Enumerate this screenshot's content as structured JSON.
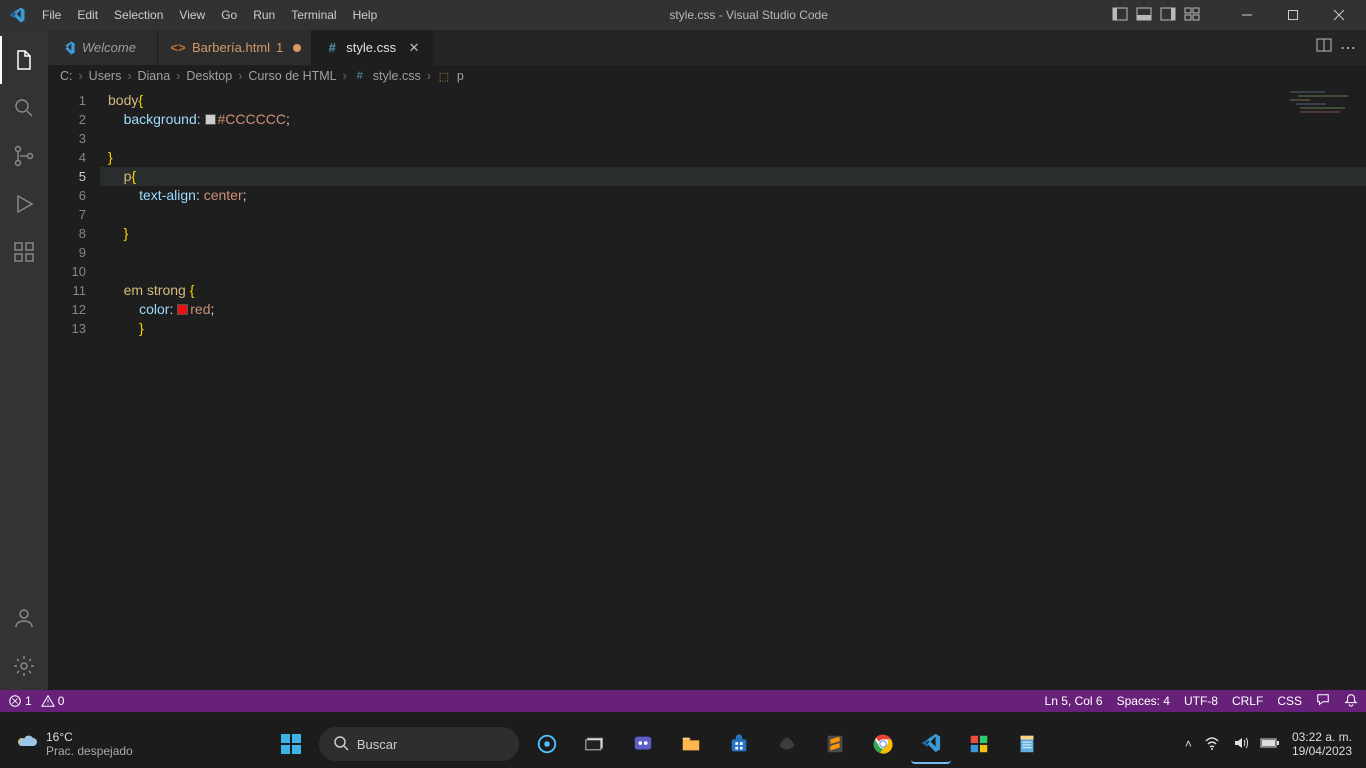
{
  "titlebar": {
    "menu": [
      "File",
      "Edit",
      "Selection",
      "View",
      "Go",
      "Run",
      "Terminal",
      "Help"
    ],
    "title": "style.css - Visual Studio Code"
  },
  "tabs": [
    {
      "id": "welcome",
      "label": "Welcome",
      "kind": "welcome",
      "modified": false,
      "active": false
    },
    {
      "id": "barberia",
      "label": "Barbería.html",
      "kind": "html",
      "modified": true,
      "suffix": "1",
      "active": false
    },
    {
      "id": "style",
      "label": "style.css",
      "kind": "css",
      "modified": false,
      "active": true
    }
  ],
  "breadcrumb": {
    "segments": [
      "C:",
      "Users",
      "Diana",
      "Desktop",
      "Curso de HTML"
    ],
    "file": "style.css",
    "symbol": "p"
  },
  "code": {
    "currentLine": 5,
    "lines": [
      {
        "n": 1,
        "indent": 0,
        "tokens": [
          [
            "sel",
            "body"
          ],
          [
            "brace",
            "{"
          ]
        ]
      },
      {
        "n": 2,
        "indent": 1,
        "tokens": [
          [
            "prop",
            "background"
          ],
          [
            "punc",
            ": "
          ],
          [
            "swatch",
            "#CCCCCC"
          ],
          [
            "val",
            "#CCCCCC"
          ],
          [
            "punc",
            ";"
          ]
        ]
      },
      {
        "n": 3,
        "indent": 0,
        "tokens": []
      },
      {
        "n": 4,
        "indent": 0,
        "tokens": [
          [
            "brace",
            "}"
          ]
        ]
      },
      {
        "n": 5,
        "indent": 1,
        "tokens": [
          [
            "sel",
            "p"
          ],
          [
            "brace",
            "{"
          ]
        ]
      },
      {
        "n": 6,
        "indent": 2,
        "tokens": [
          [
            "prop",
            "text-align"
          ],
          [
            "punc",
            ": "
          ],
          [
            "val",
            "center"
          ],
          [
            "punc",
            ";"
          ]
        ]
      },
      {
        "n": 7,
        "indent": 2,
        "tokens": []
      },
      {
        "n": 8,
        "indent": 1,
        "tokens": [
          [
            "brace",
            "}"
          ]
        ]
      },
      {
        "n": 9,
        "indent": 0,
        "tokens": []
      },
      {
        "n": 10,
        "indent": 0,
        "tokens": []
      },
      {
        "n": 11,
        "indent": 1,
        "tokens": [
          [
            "sel",
            "em "
          ],
          [
            "sel",
            "strong "
          ],
          [
            "brace",
            "{ "
          ]
        ]
      },
      {
        "n": 12,
        "indent": 2,
        "tokens": [
          [
            "prop",
            "color"
          ],
          [
            "punc",
            ": "
          ],
          [
            "swatch",
            "red"
          ],
          [
            "val",
            "red"
          ],
          [
            "punc",
            ";"
          ]
        ]
      },
      {
        "n": 13,
        "indent": 2,
        "tokens": [
          [
            "brace",
            "}"
          ]
        ]
      }
    ]
  },
  "statusbar": {
    "errors": "1",
    "warnings": "0",
    "lncol": "Ln 5, Col 6",
    "spaces": "Spaces: 4",
    "encoding": "UTF-8",
    "eol": "CRLF",
    "lang": "CSS"
  },
  "taskbar": {
    "weather_temp": "16°C",
    "weather_desc": "Prac. despejado",
    "search_placeholder": "Buscar",
    "clock_time": "03:22 a. m.",
    "clock_date": "19/04/2023"
  }
}
